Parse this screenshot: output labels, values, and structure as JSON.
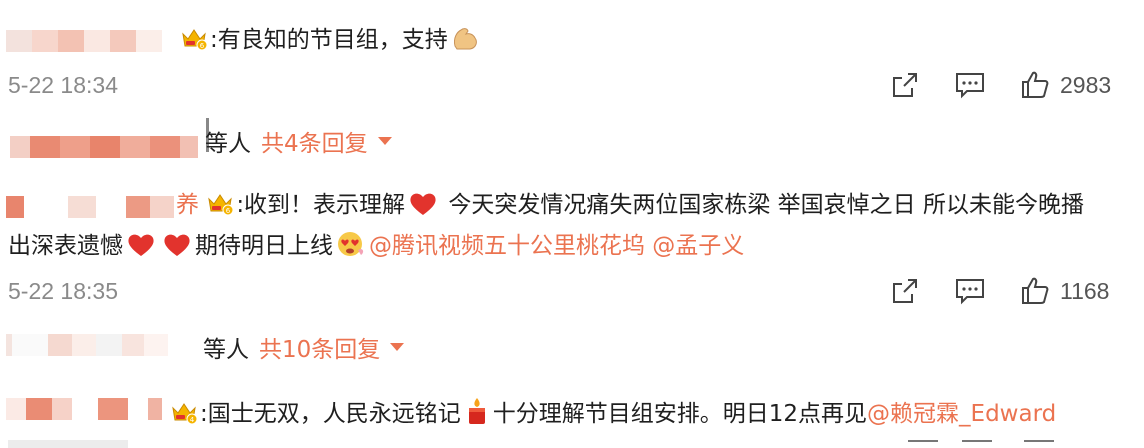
{
  "comments": [
    {
      "text": ":有良知的节目组，支持",
      "time": "5-22 18:34",
      "likes": "2983",
      "reply_prefix": "等人",
      "reply_link": "共4条回复"
    },
    {
      "name_suffix": "养",
      "text_a": ":收到！表示理解",
      "text_b": " 今天突发情况痛失两位国家栋梁 举国哀悼之日 所以未能今晚播",
      "text_c": "出深表遗憾",
      "text_d": "期待明日上线",
      "mention_1": "@腾讯视频五十公里桃花坞",
      "mention_2": " @孟子义",
      "time": "5-22 18:35",
      "likes": "1168",
      "reply_prefix": "等人",
      "reply_link": "共10条回复"
    },
    {
      "text_a": ":国士无双，人民永远铭记",
      "text_b": "十分理解节目组安排。明日12点再见",
      "mention": "@赖冠霖_Edward"
    }
  ],
  "icons": {
    "share": "share-icon",
    "comment": "comment-icon",
    "like": "like-icon",
    "crown": "crown-badge-icon",
    "heart": "red-heart-emoji",
    "muscle": "flexed-biceps-emoji",
    "heart_face": "heart-eyes-emoji",
    "candle": "candle-emoji"
  },
  "colors": {
    "link": "#eb7350",
    "muted": "#8a8a8a",
    "heart": "#e2332d"
  }
}
